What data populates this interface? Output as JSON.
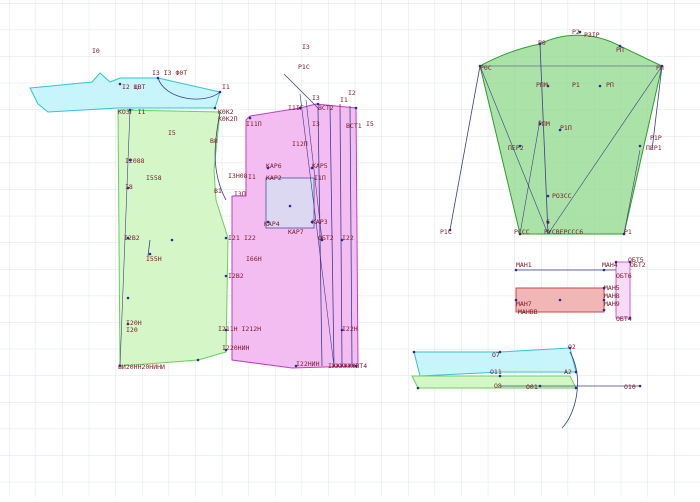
{
  "colors": {
    "grid": "#dde6ef",
    "outline": "#3b3f8a",
    "cyan_fill": "#c8f4fb",
    "cyan_stroke": "#35c3d8",
    "green_fill": "#d5f7c8",
    "green_stroke": "#67d35a",
    "magenta_fill": "#f4bdf1",
    "magenta_stroke": "#c53fbf",
    "sleeve_fill": "#8fd88a",
    "sleeve_stroke": "#2f9d2b",
    "red_fill": "#f1b7b7",
    "red_stroke": "#c84848",
    "label": "#7a1a2a",
    "point": "#2a2aa0"
  },
  "labels": {
    "l_i0": "I0",
    "l_i3top": "I3",
    "l_p1c": "P1C",
    "l_i2": "I2",
    "l_i3": "I3 I3 Ф0Т",
    "l_i1": "I1",
    "l_i5": "I5",
    "l_k0k2": "К0К2",
    "l_k0k2p": "К0К2П",
    "l_v8": "В8",
    "l_l2": "I2 ЩВТ",
    "l_kozgi": "КОЗГ I1",
    "l_i2088": "I2088",
    "l_i8": "I8",
    "l_i558": "I558",
    "l_i3h": "I3H08",
    "l_i558h": "I55H",
    "l_i21": "I21",
    "l_i22": "I22",
    "l_i66h": "I66H",
    "l_i2b2": "I2В2",
    "l_i20h": "I20H",
    "l_i20": "I20",
    "l_i211": "I211H I212H",
    "l_i220": "I220НИН",
    "l_v82": "В1",
    "l_bot": "ВИ20НН20НИНИ",
    "l_i11p": "I11П",
    "l_i10": "I1",
    "l_i3p": "I3П",
    "l_kap6": "КАР6",
    "l_kap5": "КАР5",
    "l_kap2": "КАР2",
    "l_kap4": "КАР4",
    "l_kap3": "КАР3",
    "l_kap7": "КАР7",
    "l_i12p": "I12П",
    "l_obt": "ОБТ2",
    "l_z22": "I22",
    "l_z22h": "I22H",
    "l_i1ig": "I1IГ",
    "l_i1z": "I1",
    "l_i2z": "I2",
    "l_vst1": "ВСТ1",
    "l_vst2": "ВСТ2",
    "l_i3z": "I3",
    "l_i3g": "I3",
    "l_tb": "I5",
    "l_ii": "I1П",
    "l_z22n": "I22НИН",
    "l_zbot": "IЖЖЖЖЖЖВТ4",
    "l_p0": "P0",
    "l_p2": "P2",
    "l_p3p": "P3ІР",
    "l_p0l": "P0С",
    "l_pp": "PП",
    "l_pd": "PП",
    "l_ppm": "PПМ",
    "l_p1": "P1",
    "l_p1m": "P1П",
    "l_pi": "PП",
    "l_pm": "PПМ",
    "l_pep2": "ПЕР2",
    "l_pep1": "ПЕР1",
    "l_p1l": "P1P",
    "l_p2l": "P2I",
    "l_pcc": "РОЗСС",
    "l_p6": "6",
    "l_plc": "P1C",
    "l_pbl": "РССС",
    "l_pbm": "РУСВЕРССС6",
    "l_pb1": "P1",
    "l_man1": "МАН1",
    "l_man4": "МАН4",
    "l_man5": "МАН5",
    "l_man7": "МАН7",
    "l_man8": "МАН8",
    "l_man9": "МАН9",
    "l_ob2": "ОБТ2",
    "l_ob6": "ОБТ6",
    "l_ob4": "ОБТ4",
    "l_ob5": "ОБТ5",
    "l_manbot": "МАНВВ",
    "l_o7": "О7",
    "l_o2": "О2",
    "l_o11": "О11",
    "l_o8": "О8",
    "l_o01": "О01",
    "l_o10": "О10",
    "l_a2": "А2"
  }
}
